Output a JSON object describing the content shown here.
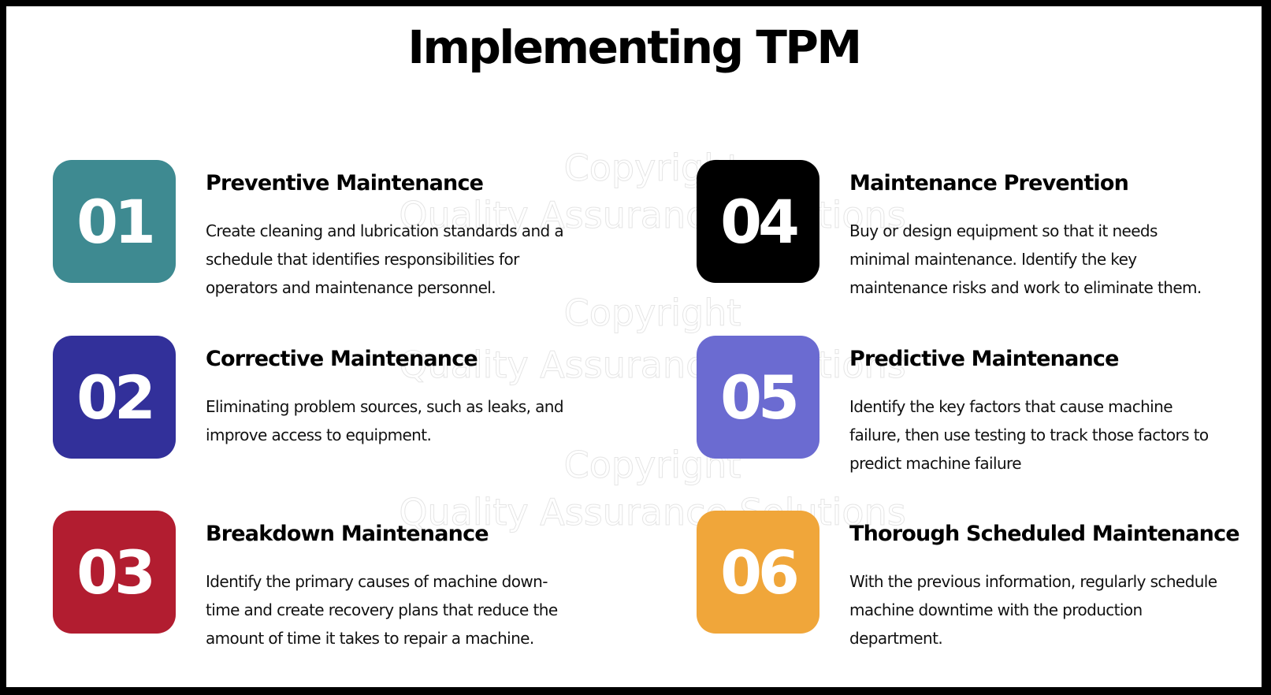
{
  "slide": {
    "title": "Implementing TPM",
    "watermark": {
      "line1": "Copyright",
      "line2": "Quality Assurance Solutions"
    },
    "items": [
      {
        "number": "01",
        "heading": "Preventive Maintenance",
        "description": "Create cleaning and lubrication standards and a schedule that identifies responsibilities for operators and maintenance personnel.",
        "color": "#3E8A91"
      },
      {
        "number": "02",
        "heading": "Corrective Maintenance",
        "description": "Eliminating problem sources, such as leaks, and improve access to equipment.",
        "color": "#32309A"
      },
      {
        "number": "03",
        "heading": "Breakdown Maintenance",
        "description": "Identify the primary causes of machine down-time and create recovery plans that reduce the amount of time it takes to repair a machine.",
        "color": "#B21D30"
      },
      {
        "number": "04",
        "heading": "Maintenance Prevention",
        "description": "Buy or design equipment so that it needs minimal maintenance. Identify the key maintenance risks and work to eliminate them.",
        "color": "#000000"
      },
      {
        "number": "05",
        "heading": "Predictive Maintenance",
        "description": "Identify the key factors that cause machine failure, then use testing to track those factors to predict machine failure",
        "color": "#6B6BD1"
      },
      {
        "number": "06",
        "heading": "Thorough Scheduled Maintenance",
        "description": "With the previous information, regularly schedule machine downtime with the production department.",
        "color": "#F0A63A"
      }
    ]
  }
}
